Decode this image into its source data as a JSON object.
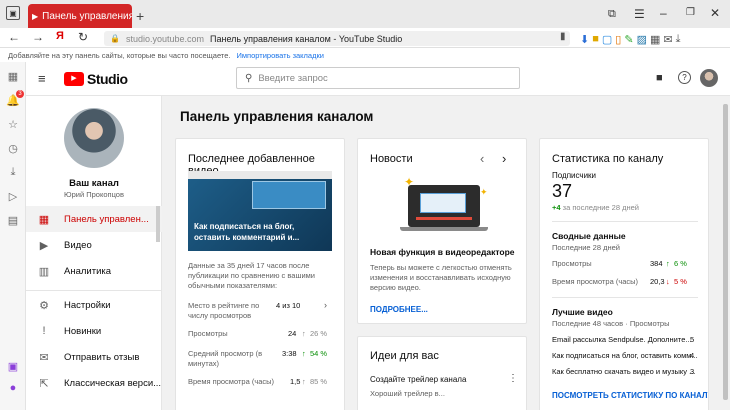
{
  "browser": {
    "tab_title": "Панель управления к",
    "url_host": "studio.youtube.com",
    "page_title": "Панель управления каналом - YouTube Studio",
    "bookmark_hint": "Добавляйте на эту панель сайты, которые вы часто посещаете.",
    "bookmark_import": "Импортировать закладки"
  },
  "header": {
    "logo_text": "Studio",
    "search_placeholder": "Введите запрос"
  },
  "sidebar": {
    "channel_label": "Ваш канал",
    "channel_owner": "Юрий Прокопцов",
    "items": [
      {
        "label": "Панель управлен..."
      },
      {
        "label": "Видео"
      },
      {
        "label": "Аналитика"
      },
      {
        "label": "Настройки"
      },
      {
        "label": "Новинки"
      },
      {
        "label": "Отправить отзыв"
      },
      {
        "label": "Классическая верси..."
      }
    ],
    "notification_count": "3"
  },
  "page_title": "Панель управления каналом",
  "latest_video": {
    "title": "Последнее добавленное видео",
    "thumb_caption": "Как подписаться на блог, оставить комментарий и...",
    "summary": "Данные за 35 дней 17 часов после публикации по сравнению с вашими обычными показателями:",
    "rows": [
      {
        "label": "Место в рейтинге по числу просмотров",
        "value": "4 из 10",
        "delta": ""
      },
      {
        "label": "Просмотры",
        "value": "24",
        "delta": "26 %"
      },
      {
        "label": "Средний просмотр (в минутах)",
        "value": "3:38",
        "delta": "54 %"
      },
      {
        "label": "Время просмотра (часы)",
        "value": "1,5",
        "delta": "85 %"
      }
    ]
  },
  "news": {
    "title": "Новости",
    "headline": "Новая функция в видеоредакторе",
    "body": "Теперь вы можете с легкостью отменять изменения и восстанавливать исходную версию видео.",
    "more": "ПОДРОБНЕЕ..."
  },
  "ideas": {
    "title": "Идеи для вас",
    "item": "Создайте трейлер канала",
    "sub": "Хороший трейлер в..."
  },
  "stats": {
    "title": "Статистика по каналу",
    "subs_label": "Подписчики",
    "subs_value": "37",
    "subs_delta": "+4",
    "subs_period": "за последние 28 дней",
    "summary_title": "Сводные данные",
    "summary_period": "Последние 28 дней",
    "views_label": "Просмотры",
    "views_value": "384",
    "views_delta": "6 %",
    "watch_label": "Время просмотра (часы)",
    "watch_value": "20,3",
    "watch_delta": "5 %",
    "best_title": "Лучшие видео",
    "best_period": "Последние 48 часов · Просмотры",
    "best": [
      {
        "title": "Email рассылка Sendpulse. Дополните...",
        "views": "5"
      },
      {
        "title": "Как подписаться на блог, оставить комм...",
        "views": "4"
      },
      {
        "title": "Как бесплатно скачать видео и музыку ...",
        "views": "3"
      }
    ],
    "more": "ПОСМОТРЕТЬ СТАТИСТИКУ ПО КАНАЛУ"
  },
  "colors": {
    "brand": "#cc0000",
    "link": "#065fd4",
    "positive": "#0a8f08"
  }
}
